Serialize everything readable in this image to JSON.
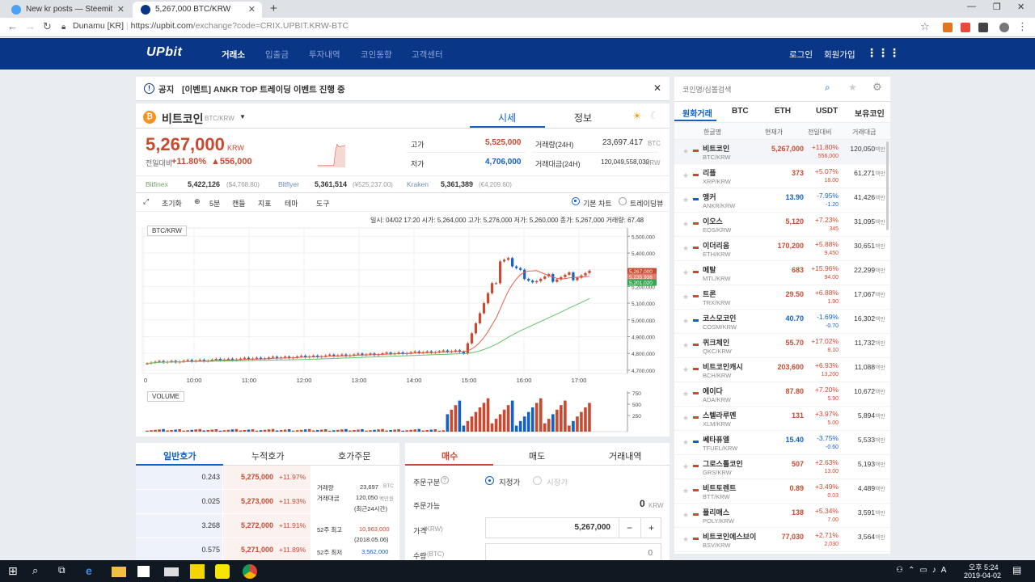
{
  "browser": {
    "tabs": [
      {
        "title": "New kr posts — Steemit",
        "active": false
      },
      {
        "title": "5,267,000 BTC/KRW",
        "active": true
      }
    ],
    "new_tab": "+",
    "site_label": "Dunamu [KR]",
    "url_host": "https://upbit.com",
    "url_path": "/exchange?code=CRIX.UPBIT.KRW-BTC"
  },
  "header": {
    "logo": "UPbit",
    "nav": [
      "거래소",
      "입출금",
      "투자내역",
      "코인동향",
      "고객센터"
    ],
    "login": "로그인",
    "signup": "회원가입"
  },
  "notice": {
    "label": "공지",
    "text": "[이벤트] ANKR TOP 트레이딩 이벤트 진행 중"
  },
  "coin": {
    "name": "비트코인",
    "pair": "BTC/KRW",
    "tab_quote": "시세",
    "tab_info": "정보",
    "price": "5,267,000",
    "price_unit": "KRW",
    "change_label": "전일대비",
    "change_pct": "+11.80%",
    "change_amt": "▲556,000",
    "high_label": "고가",
    "high": "5,525,000",
    "low_label": "저가",
    "low": "4,706,000",
    "vol_label": "거래량(24H)",
    "vol": "23,697.417",
    "vol_unit": "BTC",
    "amt_label": "거래대금(24H)",
    "amt": "120,049,558,030",
    "amt_unit": "KRW"
  },
  "exchanges": [
    {
      "name": "Bitfinex",
      "price": "5,422,126",
      "diff": "($4,768.80)"
    },
    {
      "name": "Bitflyer",
      "price": "5,361,514",
      "diff": "(¥525,237.00)"
    },
    {
      "name": "Kraken",
      "price": "5,361,389",
      "diff": "(€4,209.60)"
    }
  ],
  "toolbar": {
    "reset": "초기화",
    "interval": "5분",
    "candle": "캔들",
    "indicator": "지표",
    "theme": "테마",
    "tools": "도구",
    "basic_chart": "기본 차트",
    "tradingview": "트레이딩뷰"
  },
  "chart_info": "일시: 04/02 17:20  시가: 5,264,000  고가: 5,276,000  저가: 5,260,000  종가: 5,267,000  거래량: 67.48",
  "chart_tag": "BTC/KRW",
  "volume_tag": "VOLUME",
  "chart_data": {
    "type": "candlestick",
    "x_ticks": [
      "0",
      "10:00",
      "11:00",
      "12:00",
      "13:00",
      "14:00",
      "15:00",
      "16:00",
      "17:00"
    ],
    "y_ticks": [
      5500000,
      5400000,
      5300000,
      5200000,
      5100000,
      5000000,
      4900000,
      4800000,
      4700000
    ],
    "y_tick_labels": [
      "5,500,000",
      "5,400,000",
      "5,300,000",
      "5,200,000",
      "5,100,000",
      "5,000,000",
      "4,900,000",
      "4,800,000",
      "4,700,000"
    ],
    "ylim": [
      4680000,
      5550000
    ],
    "price_tags": [
      {
        "label": "5,267,000",
        "color": "#c84a31"
      },
      {
        "label": "5,235,938",
        "color": "#e07a6a"
      },
      {
        "label": "5,201,020",
        "color": "#34a853"
      }
    ],
    "volume_ticks": [
      "750",
      "500",
      "250"
    ],
    "ma_colors": {
      "short": "#e06050",
      "long": "#66c266"
    }
  },
  "orderbook": {
    "tabs": [
      "일반호가",
      "누적호가",
      "호가주문"
    ],
    "rows": [
      {
        "qty": "0.243",
        "price": "5,275,000",
        "pct": "+11.97%"
      },
      {
        "qty": "0.025",
        "price": "5,273,000",
        "pct": "+11.93%"
      },
      {
        "qty": "3.268",
        "price": "5,272,000",
        "pct": "+11.91%"
      },
      {
        "qty": "0.575",
        "price": "5,271,000",
        "pct": "+11.89%"
      }
    ],
    "stats": {
      "vol_label": "거래량",
      "vol": "23,697",
      "vol_unit": "BTC",
      "amt_label": "거래대금",
      "amt": "120,050",
      "amt_unit": "백만원",
      "amt_note": "(최근24시간)",
      "high52_label": "52주 최고",
      "high52": "10,963,000",
      "high52_date": "(2018.05.06)",
      "low52_label": "52주 최저",
      "low52": "3,562,000"
    }
  },
  "order": {
    "tabs": [
      "매수",
      "매도",
      "거래내역"
    ],
    "type_label": "주문구분",
    "limit": "지정가",
    "market": "시장가",
    "avail_label": "주문가능",
    "avail": "0",
    "avail_unit": "KRW",
    "price_label": "가격",
    "price_unit": "(KRW)",
    "price": "5,267,000",
    "qty_label": "수량",
    "qty_unit": "(BTC)",
    "qty": "0"
  },
  "side": {
    "search_placeholder": "코인명/심볼검색",
    "tabs": [
      "원화거래",
      "BTC",
      "ETH",
      "USDT",
      "보유코인"
    ],
    "cols": [
      "한글명",
      "현재가",
      "전일대비",
      "거래대금"
    ],
    "coins": [
      {
        "name": "비트코인",
        "code": "BTC/KRW",
        "price": "5,267,000",
        "pct": "+11.80%",
        "chg": "556,000",
        "vol": "120,050",
        "up": true
      },
      {
        "name": "리플",
        "code": "XRP/KRW",
        "price": "373",
        "pct": "+5.07%",
        "chg": "18.00",
        "vol": "61,271",
        "up": true
      },
      {
        "name": "앵커",
        "code": "ANKR/KRW",
        "price": "13.90",
        "pct": "-7.95%",
        "chg": "-1.20",
        "vol": "41,426",
        "up": false
      },
      {
        "name": "이오스",
        "code": "EOS/KRW",
        "price": "5,120",
        "pct": "+7.23%",
        "chg": "345",
        "vol": "31,095",
        "up": true
      },
      {
        "name": "이더리움",
        "code": "ETH/KRW",
        "price": "170,200",
        "pct": "+5.88%",
        "chg": "9,450",
        "vol": "30,651",
        "up": true
      },
      {
        "name": "메탈",
        "code": "MTL/KRW",
        "price": "683",
        "pct": "+15.96%",
        "chg": "94.00",
        "vol": "22,299",
        "up": true
      },
      {
        "name": "트론",
        "code": "TRX/KRW",
        "price": "29.50",
        "pct": "+6.88%",
        "chg": "1.90",
        "vol": "17,067",
        "up": true
      },
      {
        "name": "코스모코인",
        "code": "COSM/KRW",
        "price": "40.70",
        "pct": "-1.69%",
        "chg": "-0.70",
        "vol": "16,302",
        "up": false
      },
      {
        "name": "퀴크체인",
        "code": "QKC/KRW",
        "price": "55.70",
        "pct": "+17.02%",
        "chg": "8.10",
        "vol": "11,732",
        "up": true
      },
      {
        "name": "비트코인캐시",
        "code": "BCH/KRW",
        "price": "203,600",
        "pct": "+6.93%",
        "chg": "13,200",
        "vol": "11,088",
        "up": true
      },
      {
        "name": "에이다",
        "code": "ADA/KRW",
        "price": "87.80",
        "pct": "+7.20%",
        "chg": "5.90",
        "vol": "10,672",
        "up": true
      },
      {
        "name": "스텔라루멘",
        "code": "XLM/KRW",
        "price": "131",
        "pct": "+3.97%",
        "chg": "5.00",
        "vol": "5,894",
        "up": true
      },
      {
        "name": "쎄타퓨엘",
        "code": "TFUEL/KRW",
        "price": "15.40",
        "pct": "-3.75%",
        "chg": "-0.60",
        "vol": "5,533",
        "up": false
      },
      {
        "name": "그로스톨코인",
        "code": "GRS/KRW",
        "price": "507",
        "pct": "+2.63%",
        "chg": "13.00",
        "vol": "5,193",
        "up": true
      },
      {
        "name": "비트토렌트",
        "code": "BTT/KRW",
        "price": "0.89",
        "pct": "+3.49%",
        "chg": "0.03",
        "vol": "4,489",
        "up": true
      },
      {
        "name": "폴리매스",
        "code": "POLY/KRW",
        "price": "138",
        "pct": "+5.34%",
        "chg": "7.00",
        "vol": "3,591",
        "up": true
      },
      {
        "name": "비트코인에스브이",
        "code": "BSV/KRW",
        "price": "77,030",
        "pct": "+2.71%",
        "chg": "2,030",
        "vol": "3,564",
        "up": true
      }
    ],
    "vol_unit": "백만"
  },
  "taskbar": {
    "time": "오후 5:24",
    "date": "2019-04-02"
  },
  "colors": {
    "up": "#c84a31",
    "down": "#1261c4",
    "brand": "#093687"
  }
}
